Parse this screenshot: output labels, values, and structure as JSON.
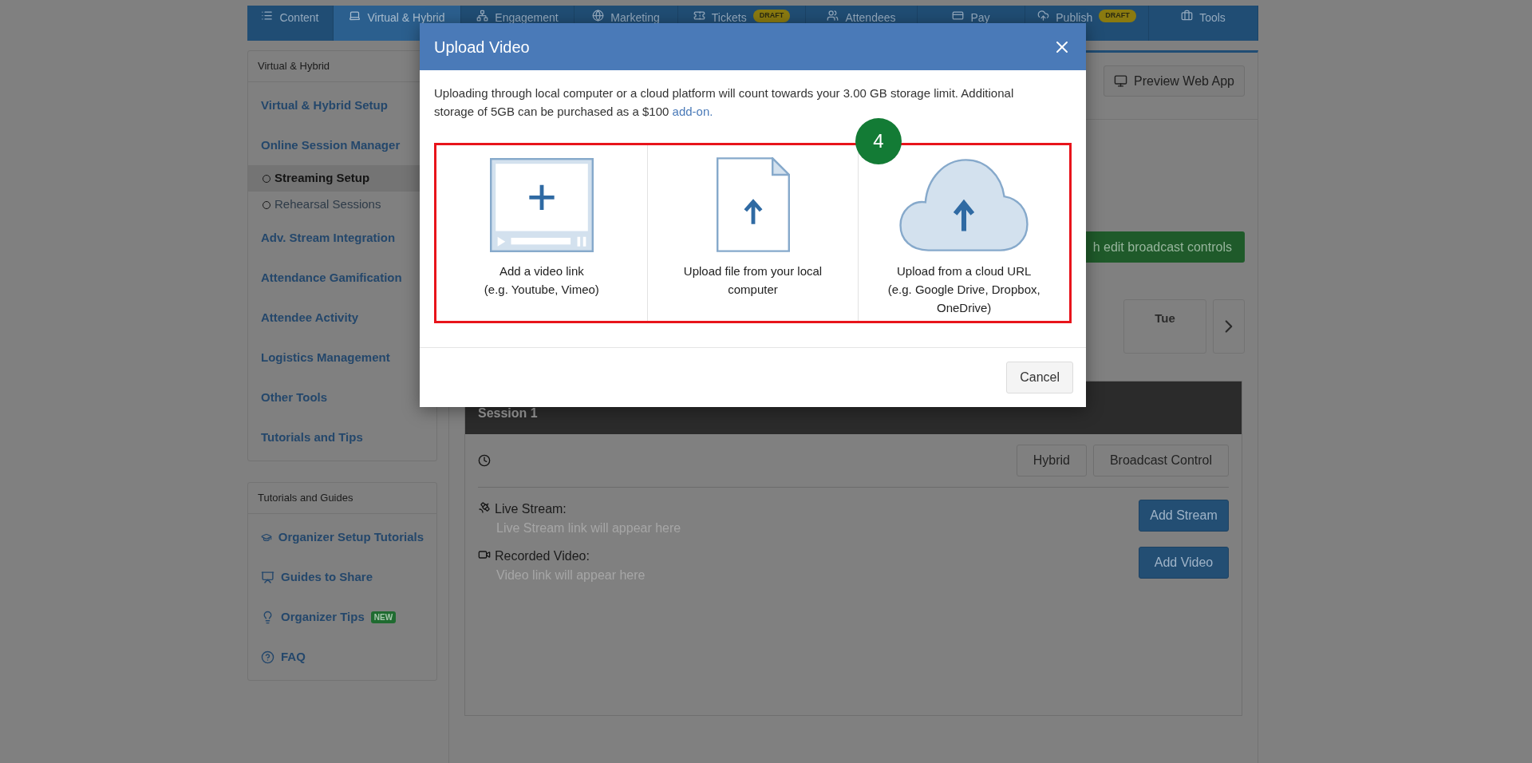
{
  "nav": {
    "tabs": [
      {
        "label": "Content",
        "selected": false
      },
      {
        "label": "Virtual & Hybrid",
        "selected": true
      },
      {
        "label": "Engagement",
        "selected": false
      },
      {
        "label": "Marketing",
        "selected": false
      },
      {
        "label": "Tickets",
        "selected": false,
        "badge": "DRAFT"
      },
      {
        "label": "Attendees",
        "selected": false
      },
      {
        "label": "Pay",
        "selected": false
      },
      {
        "label": "Publish",
        "selected": false,
        "badge": "DRAFT"
      },
      {
        "label": "Tools",
        "selected": false
      }
    ]
  },
  "sidebar": {
    "sections": [
      {
        "title": "Virtual & Hybrid",
        "items": [
          {
            "kind": "link",
            "label": "Virtual & Hybrid Setup"
          },
          {
            "kind": "link",
            "label": "Online Session Manager"
          },
          {
            "kind": "subitem",
            "label": "Streaming Setup",
            "selected": true
          },
          {
            "kind": "subitem",
            "label": "Rehearsal Sessions",
            "selected": false
          },
          {
            "kind": "link",
            "label": "Adv. Stream Integration"
          },
          {
            "kind": "link",
            "label": "Attendance Gamification"
          },
          {
            "kind": "link",
            "label": "Attendee Activity"
          },
          {
            "kind": "link",
            "label": "Logistics Management"
          },
          {
            "kind": "link",
            "label": "Other Tools"
          },
          {
            "kind": "link",
            "label": "Tutorials and Tips"
          }
        ]
      },
      {
        "title": "Tutorials and Guides",
        "items": [
          {
            "kind": "icon_link",
            "label": "Organizer Setup Tutorials"
          },
          {
            "kind": "icon_link",
            "label": "Guides to Share"
          },
          {
            "kind": "icon_link",
            "label": "Organizer Tips",
            "badge": "NEW"
          },
          {
            "kind": "icon_link",
            "label": "FAQ"
          }
        ]
      }
    ]
  },
  "main": {
    "preview_button": "Preview Web App",
    "broadcast_button": "h edit broadcast controls",
    "days": [
      {
        "label": "Tue"
      }
    ],
    "session": {
      "title": "Session 1",
      "buttons": [
        "Hybrid",
        "Broadcast Control"
      ],
      "rows": [
        {
          "label": "Live Stream:",
          "hint": "Live Stream link will appear here",
          "button": "Add Stream"
        },
        {
          "label": "Recorded Video:",
          "hint": "Video link will appear here",
          "button": "Add Video"
        }
      ]
    }
  },
  "modal": {
    "title": "Upload Video",
    "intro": "Uploading through local computer or a cloud platform will count towards your 3.00 GB storage limit. Additional storage of 5GB can be purchased as a $100",
    "link": "add-on.",
    "step": "4",
    "options": [
      {
        "kind": "video",
        "label": "Add a video link\n(e.g. Youtube, Vimeo)"
      },
      {
        "kind": "file",
        "label": "Upload file from your local\ncomputer"
      },
      {
        "kind": "cloud",
        "label": "Upload from a cloud URL\n(e.g. Google Drive, Dropbox,\nOneDrive)"
      }
    ],
    "cancel": "Cancel"
  }
}
